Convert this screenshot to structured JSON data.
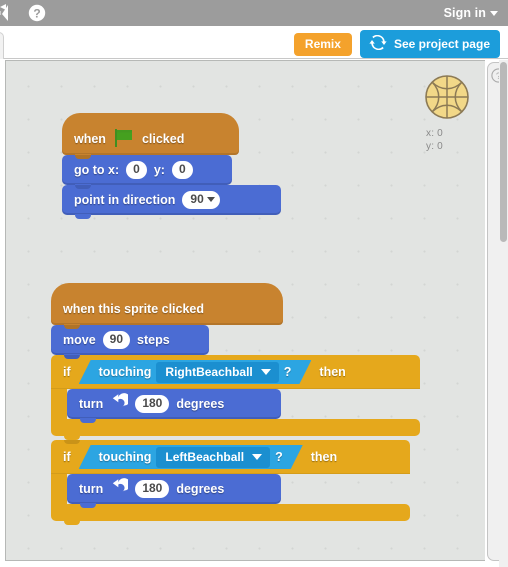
{
  "menubar": {
    "logo_icon": "scratch-logo-icon",
    "help_icon": "help-icon",
    "signin_label": "Sign in"
  },
  "subbar": {
    "remix_label": "Remix",
    "see_project_page_label": "See project page",
    "see_project_page_icon": "refresh-loop-icon"
  },
  "sprite_info": {
    "thumbnail_icon": "basketball-sprite-icon",
    "x_label": "x:",
    "x_value": "0",
    "y_label": "y:",
    "y_value": "0"
  },
  "help_panel": {
    "question_icon": "question-mark-icon"
  },
  "scripts": [
    {
      "id": "script-green-flag",
      "blocks": [
        {
          "type": "event-hat",
          "name": "when-green-flag-clicked",
          "words": [
            "when",
            "clicked"
          ],
          "icon": "green-flag-icon"
        },
        {
          "type": "motion",
          "name": "go-to-xy",
          "label_1": "go  to  x:",
          "value_x": "0",
          "label_2": "y:",
          "value_y": "0"
        },
        {
          "type": "motion",
          "name": "point-in-direction",
          "label_1": "point  in  direction",
          "value": "90"
        }
      ]
    },
    {
      "id": "script-sprite-clicked",
      "blocks": [
        {
          "type": "event-hat",
          "name": "when-this-sprite-clicked",
          "label": "when  this  sprite  clicked"
        },
        {
          "type": "motion",
          "name": "move-steps",
          "label_1": "move",
          "value": "90",
          "label_2": "steps"
        },
        {
          "type": "control-if",
          "name": "if-touching-right-then",
          "if_label": "if",
          "then_label": "then",
          "condition": {
            "name": "touching-sensing-block",
            "label": "touching",
            "target": "RightBeachball",
            "question_mark": "?"
          },
          "body": [
            {
              "type": "motion",
              "name": "turn-counterclockwise-degrees",
              "label_1": "turn",
              "icon": "turn-ccw-icon",
              "value": "180",
              "label_2": "degrees"
            }
          ]
        },
        {
          "type": "control-if",
          "name": "if-touching-left-then",
          "if_label": "if",
          "then_label": "then",
          "condition": {
            "name": "touching-sensing-block",
            "label": "touching",
            "target": "LeftBeachball",
            "question_mark": "?"
          },
          "body": [
            {
              "type": "motion",
              "name": "turn-counterclockwise-degrees",
              "label_1": "turn",
              "icon": "turn-ccw-icon",
              "value": "180",
              "label_2": "degrees"
            }
          ]
        }
      ]
    }
  ],
  "colors": {
    "menubar_bg": "#9c9c9c",
    "event_block": "#c8832f",
    "motion_block": "#4b6cd3",
    "control_block": "#e5a81c",
    "sensing_block": "#2ca5e2",
    "remix_button": "#f4a22c",
    "project_page_button": "#1c9ddb",
    "workspace_bg": "#e2e4e2"
  }
}
